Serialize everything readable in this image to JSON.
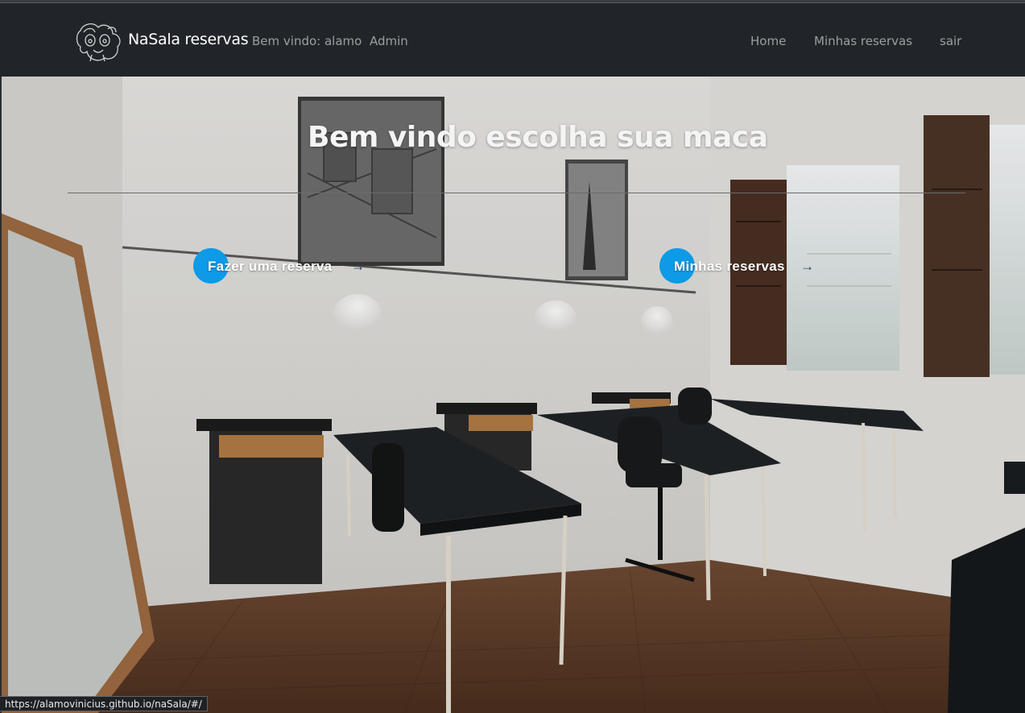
{
  "navbar": {
    "brand": "NaSala reservas",
    "welcome": "Bem vindo: alamo",
    "admin_link": "Admin",
    "links": {
      "home": "Home",
      "minhas_reservas": "Minhas reservas",
      "sair": "sair"
    }
  },
  "hero": {
    "title": "Bem vindo escolha sua maca",
    "cta_reserva": "Fazer uma reserva",
    "cta_minhas": "Minhas reservas",
    "arrow": "→",
    "background_icon": "massage-room-photo"
  },
  "statusbar": {
    "url": "https://alamovinicius.github.io/naSala/#/"
  },
  "colors": {
    "navbar_bg": "#212529",
    "cta_accent": "#0d9ae6",
    "nav_text": "rgba(255,255,255,.55)"
  }
}
